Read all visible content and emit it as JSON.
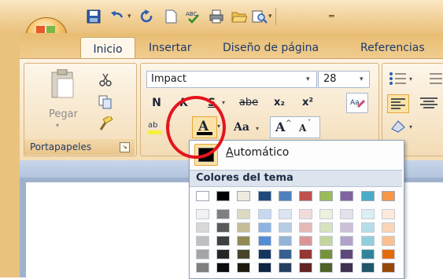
{
  "tabs": [
    {
      "label": "Inicio"
    },
    {
      "label": "Insertar"
    },
    {
      "label": "Diseño de página"
    },
    {
      "label": "Referencias"
    }
  ],
  "clipboard": {
    "paste_label": "Pegar",
    "group_label": "Portapapeles"
  },
  "font": {
    "name": "Impact",
    "size": "28"
  },
  "format_buttons": [
    "N",
    "K",
    "S",
    "abe",
    "x₂",
    "x²"
  ],
  "color_menu": {
    "automatic_label": "Automático",
    "automatic_underline": "A",
    "theme_header": "Colores del tema"
  },
  "theme_colors": {
    "top_row": [
      "#ffffff",
      "#000000",
      "#eeece1",
      "#1f497d",
      "#4f81bd",
      "#c0504d",
      "#9bbb59",
      "#8064a2",
      "#4bacc6",
      "#f79646"
    ],
    "shade_rows": [
      [
        "#f2f2f2",
        "#7f7f7f",
        "#ddd9c3",
        "#c6d9f0",
        "#dbe5f1",
        "#f2dcdb",
        "#ebf1dd",
        "#e5e0ec",
        "#dbeef3",
        "#fdeada"
      ],
      [
        "#d8d8d8",
        "#595959",
        "#c4bd97",
        "#8db3e2",
        "#b8cce4",
        "#e5b9b7",
        "#d7e3bc",
        "#ccc1d9",
        "#b7dde8",
        "#fbd5b5"
      ],
      [
        "#bfbfbf",
        "#3f3f3f",
        "#938953",
        "#548dd4",
        "#95b3d7",
        "#d99694",
        "#c3d69b",
        "#b2a2c7",
        "#92cddc",
        "#fac08f"
      ],
      [
        "#a5a5a5",
        "#262626",
        "#494429",
        "#17365d",
        "#366092",
        "#953734",
        "#76923c",
        "#5f497a",
        "#31859b",
        "#e36c09"
      ],
      [
        "#7f7f7f",
        "#0c0c0c",
        "#1d1b10",
        "#0f243e",
        "#244061",
        "#632423",
        "#4f6128",
        "#3f3151",
        "#205867",
        "#974806"
      ]
    ]
  },
  "colors": {
    "highlight": "#e4141d",
    "selected_font_color": "#000000"
  }
}
